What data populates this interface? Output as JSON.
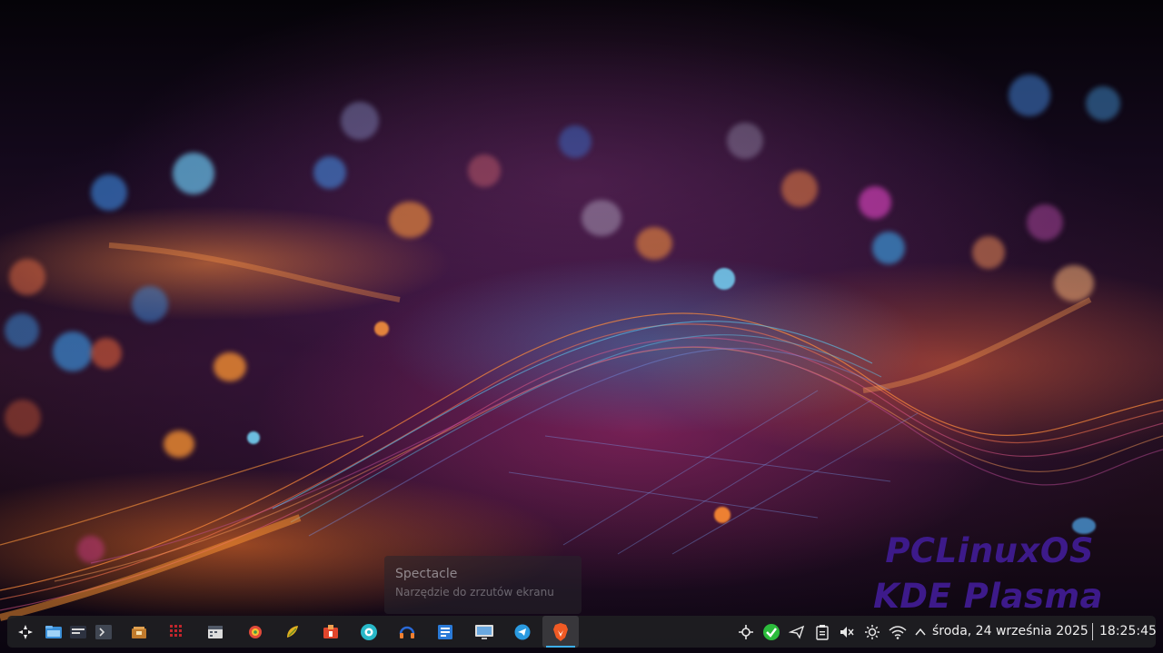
{
  "watermark": {
    "line1": "PCLinuxOS",
    "line2": "KDE Plasma"
  },
  "tooltip": {
    "title": "Spectacle",
    "subtitle": "Narzędzie do zrzutów ekranu"
  },
  "taskbar": {
    "launcher": "application-launcher-icon",
    "apps": [
      {
        "name": "file-manager-icon"
      },
      {
        "name": "system-monitor-icon"
      },
      {
        "name": "terminal-icon"
      },
      {
        "name": "package-manager-icon"
      },
      {
        "name": "calculator-icon"
      },
      {
        "name": "calendar-app-icon"
      },
      {
        "name": "image-viewer-icon"
      },
      {
        "name": "archive-manager-icon"
      },
      {
        "name": "software-center-icon"
      },
      {
        "name": "system-settings-icon"
      },
      {
        "name": "audio-player-icon"
      },
      {
        "name": "office-document-icon"
      },
      {
        "name": "remote-desktop-icon"
      },
      {
        "name": "telegram-icon"
      },
      {
        "name": "brave-browser-icon"
      }
    ]
  },
  "tray": {
    "icons": [
      "kde-connect-icon",
      "update-ok-icon",
      "send-icon",
      "clipboard-icon",
      "volume-muted-icon",
      "brightness-icon",
      "wifi-icon",
      "expand-tray-icon"
    ]
  },
  "clock": {
    "date": "środa, 24 września 2025",
    "time": "18:25:45"
  }
}
